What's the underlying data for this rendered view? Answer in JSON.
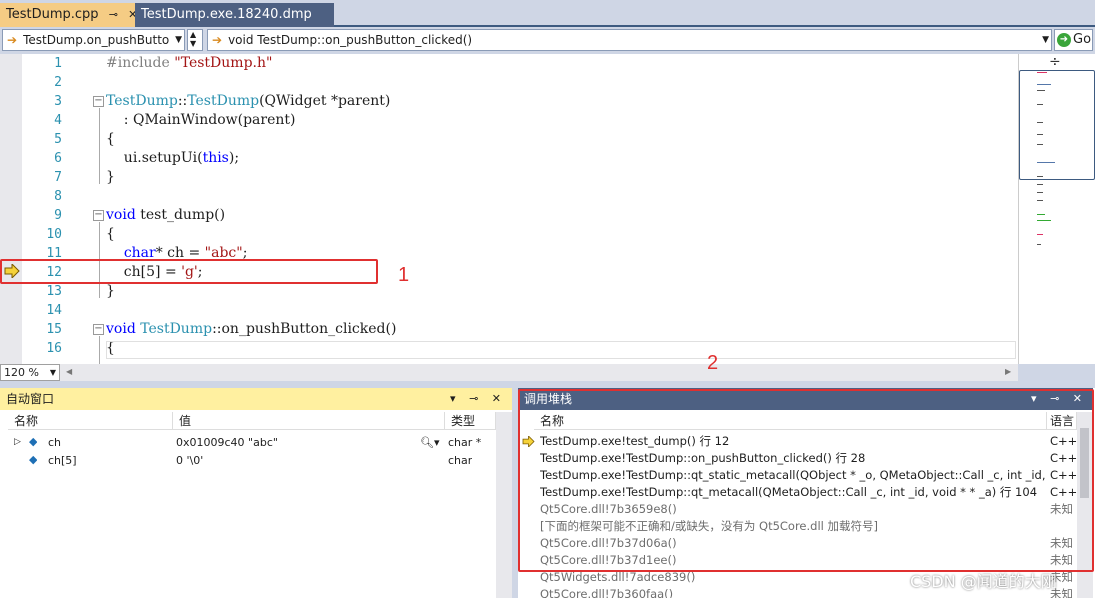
{
  "tabs": [
    {
      "label": "TestDump.cpp",
      "pin": "⊸",
      "close": "✕"
    },
    {
      "label": "TestDump.exe.18240.dmp"
    }
  ],
  "nav": {
    "scope": "TestDump.on_pushButto",
    "member": "void TestDump::on_pushButton_clicked()",
    "go": "Go"
  },
  "editor": {
    "line_numbers": [
      "1",
      "2",
      "3",
      "4",
      "5",
      "6",
      "7",
      "8",
      "9",
      "10",
      "11",
      "12",
      "13",
      "14",
      "15",
      "16"
    ],
    "zoom": "120 %",
    "current_line": "12"
  },
  "annotations": {
    "label1": "1",
    "label2": "2"
  },
  "autos": {
    "title": "自动窗口",
    "tools": "▾ ⊸ ✕",
    "columns": {
      "name": "名称",
      "value": "值",
      "type": "类型"
    },
    "rows": [
      {
        "name": "ch",
        "value": "0x01009c40 \"abc\"",
        "type": "char *"
      },
      {
        "name": "ch[5]",
        "value": "0 '\\0'",
        "type": "char"
      }
    ]
  },
  "stack": {
    "title": "调用堆栈",
    "tools": "▾ ⊸ ✕",
    "columns": {
      "name": "名称",
      "lang": "语言"
    },
    "rows": [
      {
        "name": "TestDump.exe!test_dump() 行 12",
        "lang": "C++"
      },
      {
        "name": "TestDump.exe!TestDump::on_pushButton_clicked() 行 28",
        "lang": "C++"
      },
      {
        "name": "TestDump.exe!TestDump::qt_static_metacall(QObject * _o, QMetaObject::Call _c, int _id, void * * _a",
        "lang": "C++"
      },
      {
        "name": "TestDump.exe!TestDump::qt_metacall(QMetaObject::Call _c, int _id, void * * _a) 行 104",
        "lang": "C++"
      },
      {
        "name": "Qt5Core.dll!7b3659e8()",
        "lang": "未知"
      },
      {
        "name": "[下面的框架可能不正确和/或缺失，没有为 Qt5Core.dll 加载符号]",
        "lang": ""
      },
      {
        "name": "Qt5Core.dll!7b37d06a()",
        "lang": "未知"
      },
      {
        "name": "Qt5Core.dll!7b37d1ee()",
        "lang": "未知"
      },
      {
        "name": "Qt5Widgets.dll!7adce839()",
        "lang": "未知"
      },
      {
        "name": "Qt5Core.dll!7b360faa()",
        "lang": "未知"
      }
    ]
  },
  "watermark": "CSDN @闻道的大刚",
  "colors": {
    "accent_red": "#e03030",
    "tab_active": "#f5cc84",
    "panel_blue": "#4d6082"
  }
}
